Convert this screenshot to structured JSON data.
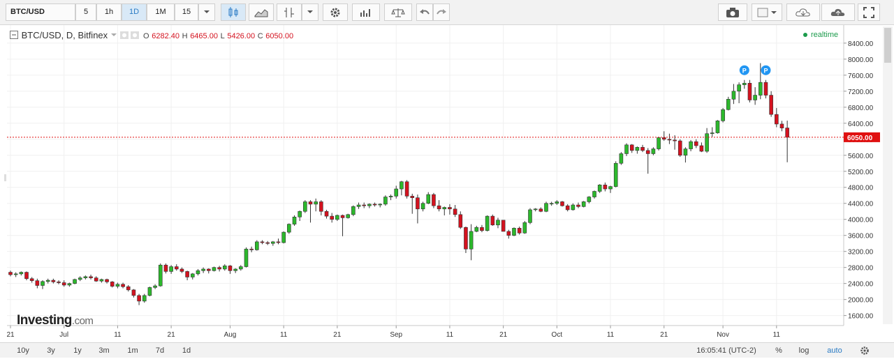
{
  "toolbar": {
    "symbol": "BTC/USD",
    "intervals": [
      "5",
      "1h",
      "1D",
      "1M",
      "15"
    ],
    "active_interval": "1D"
  },
  "legend": {
    "title": "BTC/USD, D, Bitfinex",
    "open_label": "O",
    "open": "6282.40",
    "high_label": "H",
    "high": "6465.00",
    "low_label": "L",
    "low": "5426.00",
    "close_label": "C",
    "close": "6050.00"
  },
  "realtime_label": "realtime",
  "watermark": {
    "brand": "Investing",
    "suffix": ".com"
  },
  "bottom": {
    "ranges": [
      "10y",
      "3y",
      "1y",
      "3m",
      "1m",
      "7d",
      "1d"
    ],
    "time": "16:05:41 (UTC-2)",
    "options": [
      "%",
      "log",
      "auto"
    ],
    "active_option": "auto"
  },
  "colors": {
    "up": "#2cb82c",
    "down": "#d4121f",
    "price_line": "#e01010"
  },
  "chart_data": {
    "type": "candlestick",
    "last_price": 6050.0,
    "ylim": [
      1350,
      8850
    ],
    "y_ticks": [
      1600,
      2000,
      2400,
      2800,
      3200,
      3600,
      4000,
      4400,
      4800,
      5200,
      5600,
      6000,
      6400,
      6800,
      7200,
      7600,
      8000,
      8400
    ],
    "y_tick_labels": [
      "1600.00",
      "2000.00",
      "2400.00",
      "2800.00",
      "3200.00",
      "3600.00",
      "4000.00",
      "4400.00",
      "4800.00",
      "5200.00",
      "5600.00",
      "6000.00",
      "6400.00",
      "6800.00",
      "7200.00",
      "7600.00",
      "8000.00",
      "8400.00"
    ],
    "last_price_label": "6050.00",
    "x_labels": [
      {
        "label": "21",
        "i": 0
      },
      {
        "label": "Jul",
        "i": 10
      },
      {
        "label": "11",
        "i": 20
      },
      {
        "label": "21",
        "i": 30
      },
      {
        "label": "Aug",
        "i": 41
      },
      {
        "label": "11",
        "i": 51
      },
      {
        "label": "21",
        "i": 61
      },
      {
        "label": "Sep",
        "i": 72
      },
      {
        "label": "11",
        "i": 82
      },
      {
        "label": "21",
        "i": 92
      },
      {
        "label": "Oct",
        "i": 102
      },
      {
        "label": "11",
        "i": 112
      },
      {
        "label": "21",
        "i": 122
      },
      {
        "label": "Nov",
        "i": 133
      },
      {
        "label": "11",
        "i": 143
      }
    ],
    "markers": [
      {
        "i": 137,
        "label": "P"
      },
      {
        "i": 141,
        "label": "P"
      }
    ],
    "ohlc": [
      [
        2680,
        2720,
        2580,
        2620
      ],
      [
        2620,
        2680,
        2560,
        2640
      ],
      [
        2640,
        2700,
        2600,
        2680
      ],
      [
        2680,
        2700,
        2480,
        2520
      ],
      [
        2520,
        2560,
        2420,
        2470
      ],
      [
        2470,
        2520,
        2280,
        2350
      ],
      [
        2350,
        2480,
        2260,
        2450
      ],
      [
        2450,
        2520,
        2400,
        2480
      ],
      [
        2480,
        2520,
        2400,
        2440
      ],
      [
        2440,
        2480,
        2380,
        2420
      ],
      [
        2420,
        2480,
        2320,
        2360
      ],
      [
        2360,
        2420,
        2320,
        2400
      ],
      [
        2400,
        2520,
        2380,
        2500
      ],
      [
        2500,
        2580,
        2460,
        2540
      ],
      [
        2540,
        2600,
        2500,
        2570
      ],
      [
        2570,
        2620,
        2500,
        2540
      ],
      [
        2540,
        2580,
        2440,
        2460
      ],
      [
        2460,
        2520,
        2420,
        2500
      ],
      [
        2500,
        2520,
        2400,
        2440
      ],
      [
        2440,
        2460,
        2300,
        2330
      ],
      [
        2330,
        2420,
        2280,
        2380
      ],
      [
        2380,
        2420,
        2280,
        2320
      ],
      [
        2320,
        2360,
        2200,
        2240
      ],
      [
        2240,
        2260,
        2050,
        2100
      ],
      [
        2100,
        2140,
        1860,
        1960
      ],
      [
        1960,
        2140,
        1920,
        2100
      ],
      [
        2100,
        2320,
        2080,
        2300
      ],
      [
        2300,
        2380,
        2260,
        2340
      ],
      [
        2340,
        2900,
        2320,
        2860
      ],
      [
        2860,
        2900,
        2650,
        2700
      ],
      [
        2700,
        2860,
        2640,
        2820
      ],
      [
        2820,
        2880,
        2720,
        2760
      ],
      [
        2760,
        2800,
        2660,
        2700
      ],
      [
        2700,
        2720,
        2480,
        2560
      ],
      [
        2560,
        2660,
        2500,
        2640
      ],
      [
        2640,
        2760,
        2600,
        2720
      ],
      [
        2720,
        2800,
        2660,
        2760
      ],
      [
        2760,
        2780,
        2650,
        2720
      ],
      [
        2720,
        2820,
        2700,
        2800
      ],
      [
        2800,
        2840,
        2700,
        2760
      ],
      [
        2760,
        2880,
        2720,
        2840
      ],
      [
        2840,
        2860,
        2640,
        2720
      ],
      [
        2720,
        2780,
        2660,
        2760
      ],
      [
        2760,
        2860,
        2720,
        2820
      ],
      [
        2820,
        3300,
        2800,
        3260
      ],
      [
        3260,
        3320,
        3180,
        3240
      ],
      [
        3240,
        3480,
        3220,
        3440
      ],
      [
        3440,
        3480,
        3380,
        3420
      ],
      [
        3420,
        3460,
        3360,
        3400
      ],
      [
        3400,
        3460,
        3340,
        3440
      ],
      [
        3440,
        3520,
        3380,
        3420
      ],
      [
        3420,
        3700,
        3400,
        3680
      ],
      [
        3680,
        3900,
        3640,
        3880
      ],
      [
        3880,
        4100,
        3840,
        4060
      ],
      [
        4060,
        4220,
        3960,
        4200
      ],
      [
        4200,
        4480,
        4160,
        4440
      ],
      [
        4440,
        4480,
        3920,
        4380
      ],
      [
        4380,
        4520,
        4200,
        4440
      ],
      [
        4440,
        4480,
        4100,
        4200
      ],
      [
        4200,
        4240,
        4020,
        4080
      ],
      [
        4080,
        4160,
        3920,
        4000
      ],
      [
        4000,
        4120,
        3960,
        4100
      ],
      [
        4100,
        4120,
        3580,
        4040
      ],
      [
        4040,
        4140,
        4020,
        4120
      ],
      [
        4120,
        4350,
        4080,
        4320
      ],
      [
        4320,
        4420,
        4260,
        4360
      ],
      [
        4360,
        4420,
        4280,
        4340
      ],
      [
        4340,
        4400,
        4280,
        4380
      ],
      [
        4380,
        4420,
        4320,
        4360
      ],
      [
        4360,
        4400,
        4300,
        4380
      ],
      [
        4380,
        4600,
        4340,
        4560
      ],
      [
        4560,
        4620,
        4480,
        4580
      ],
      [
        4580,
        4840,
        4520,
        4760
      ],
      [
        4760,
        4960,
        4600,
        4940
      ],
      [
        4940,
        4980,
        4520,
        4580
      ],
      [
        4580,
        4640,
        4140,
        4540
      ],
      [
        4540,
        4620,
        3900,
        4260
      ],
      [
        4260,
        4440,
        4200,
        4400
      ],
      [
        4400,
        4680,
        4380,
        4620
      ],
      [
        4620,
        4660,
        4280,
        4340
      ],
      [
        4340,
        4480,
        4200,
        4260
      ],
      [
        4260,
        4320,
        4100,
        4300
      ],
      [
        4300,
        4380,
        4120,
        4260
      ],
      [
        4260,
        4360,
        4060,
        4120
      ],
      [
        4120,
        4200,
        3760,
        3800
      ],
      [
        3800,
        3820,
        3160,
        3260
      ],
      [
        3260,
        3880,
        2980,
        3700
      ],
      [
        3700,
        3840,
        3680,
        3800
      ],
      [
        3800,
        3860,
        3680,
        3720
      ],
      [
        3720,
        4100,
        3700,
        4080
      ],
      [
        4080,
        4120,
        3840,
        3860
      ],
      [
        3860,
        4040,
        3780,
        3980
      ],
      [
        3980,
        3980,
        3700,
        3700
      ],
      [
        3700,
        3740,
        3520,
        3600
      ],
      [
        3600,
        3800,
        3580,
        3780
      ],
      [
        3780,
        3820,
        3620,
        3660
      ],
      [
        3660,
        3960,
        3640,
        3920
      ],
      [
        3920,
        4280,
        3880,
        4240
      ],
      [
        4240,
        4280,
        4200,
        4260
      ],
      [
        4260,
        4300,
        4180,
        4200
      ],
      [
        4200,
        4440,
        4180,
        4400
      ],
      [
        4400,
        4440,
        4340,
        4400
      ],
      [
        4400,
        4480,
        4360,
        4440
      ],
      [
        4440,
        4460,
        4320,
        4340
      ],
      [
        4340,
        4380,
        4200,
        4240
      ],
      [
        4240,
        4400,
        4220,
        4360
      ],
      [
        4360,
        4420,
        4280,
        4320
      ],
      [
        4320,
        4460,
        4300,
        4440
      ],
      [
        4440,
        4580,
        4400,
        4560
      ],
      [
        4560,
        4720,
        4520,
        4700
      ],
      [
        4700,
        4880,
        4660,
        4860
      ],
      [
        4860,
        4920,
        4700,
        4760
      ],
      [
        4760,
        4840,
        4660,
        4820
      ],
      [
        4820,
        5450,
        4800,
        5400
      ],
      [
        5400,
        5680,
        5360,
        5640
      ],
      [
        5640,
        5900,
        5580,
        5860
      ],
      [
        5860,
        5880,
        5660,
        5720
      ],
      [
        5720,
        5820,
        5640,
        5800
      ],
      [
        5800,
        5860,
        5680,
        5720
      ],
      [
        5720,
        5780,
        5140,
        5640
      ],
      [
        5640,
        5800,
        5600,
        5760
      ],
      [
        5760,
        6060,
        5720,
        6040
      ],
      [
        6040,
        6200,
        5960,
        6000
      ],
      [
        6000,
        6140,
        5880,
        5980
      ],
      [
        5980,
        6100,
        5740,
        5960
      ],
      [
        5960,
        6000,
        5560,
        5600
      ],
      [
        5600,
        5800,
        5420,
        5760
      ],
      [
        5760,
        5980,
        5700,
        5940
      ],
      [
        5940,
        6000,
        5780,
        5840
      ],
      [
        5840,
        5920,
        5680,
        5700
      ],
      [
        5700,
        6280,
        5660,
        6140
      ],
      [
        6140,
        6300,
        6060,
        6160
      ],
      [
        6160,
        6480,
        6140,
        6460
      ],
      [
        6460,
        6780,
        6420,
        6740
      ],
      [
        6740,
        7060,
        6720,
        7000
      ],
      [
        7000,
        7380,
        6880,
        7200
      ],
      [
        7200,
        7420,
        6900,
        7360
      ],
      [
        7360,
        7480,
        7260,
        7400
      ],
      [
        7400,
        7480,
        6920,
        6980
      ],
      [
        6980,
        7300,
        6860,
        7100
      ],
      [
        7100,
        7900,
        7000,
        7420
      ],
      [
        7420,
        7480,
        7020,
        7100
      ],
      [
        7100,
        7200,
        6560,
        6620
      ],
      [
        6620,
        6780,
        6300,
        6380
      ],
      [
        6380,
        6460,
        6200,
        6280
      ],
      [
        6282.4,
        6465,
        5426,
        6050
      ]
    ]
  }
}
